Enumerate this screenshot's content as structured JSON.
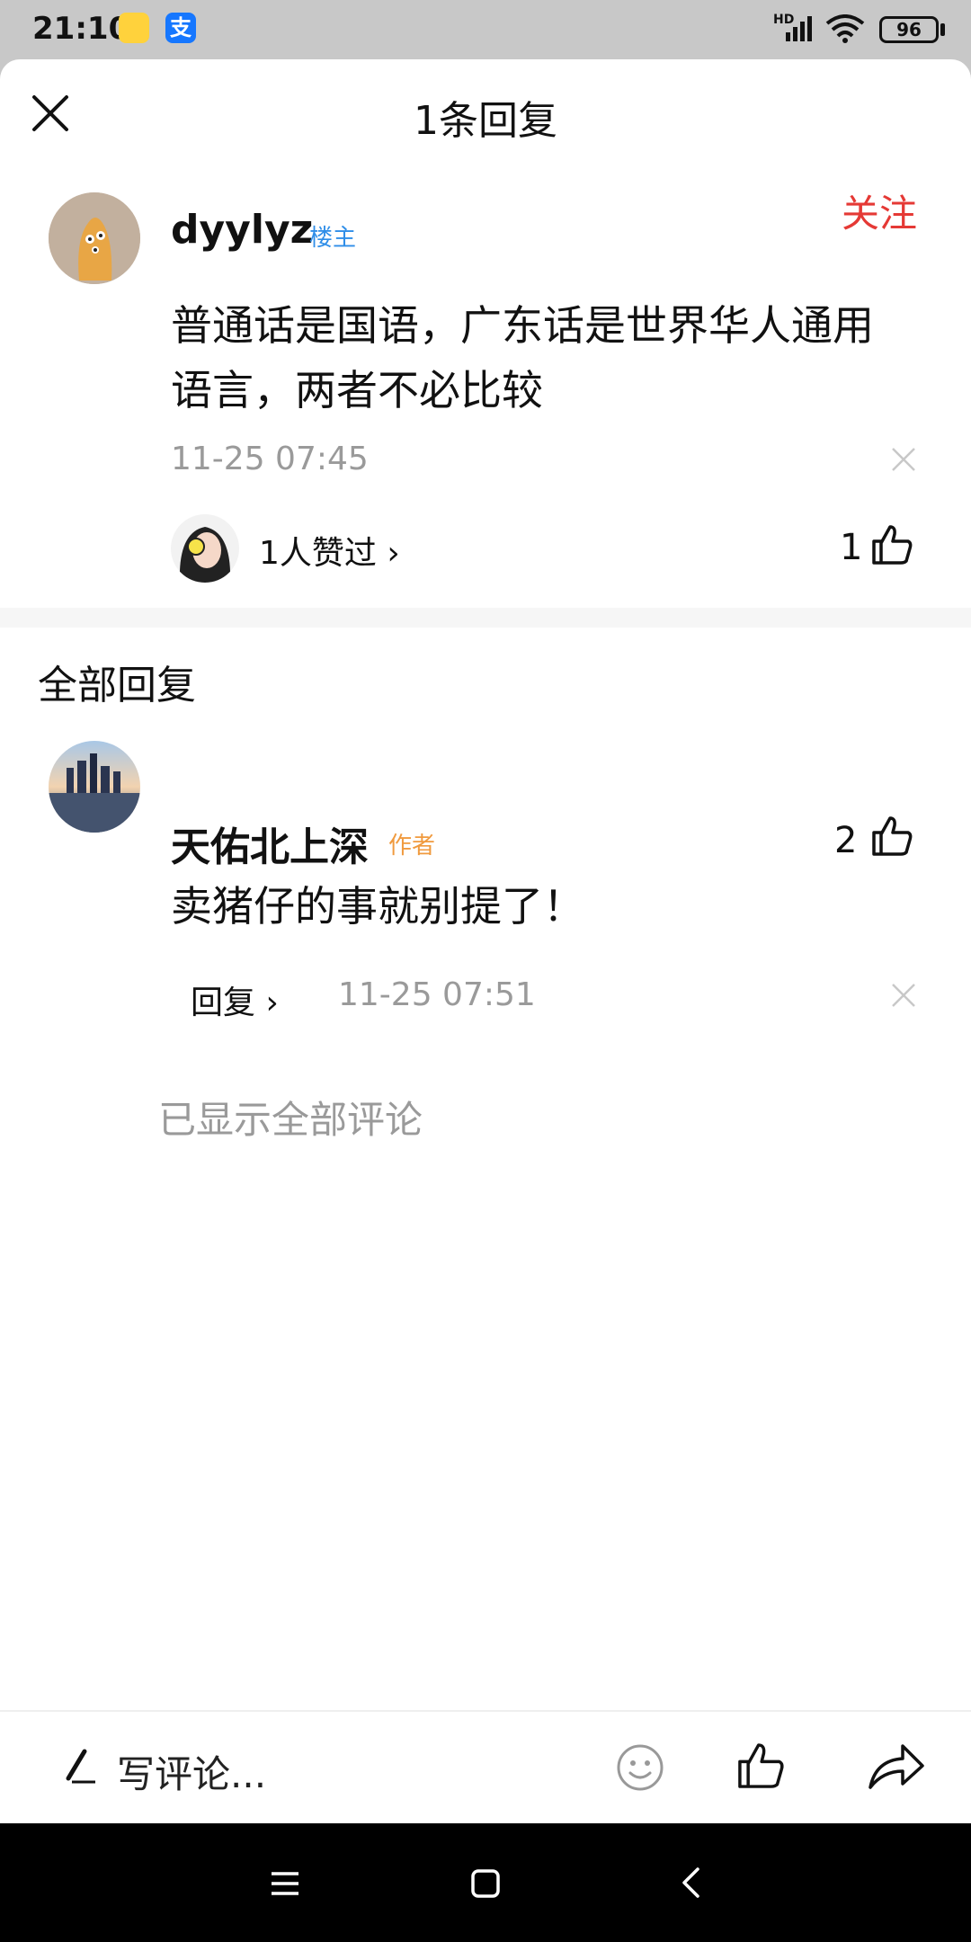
{
  "status_bar": {
    "time": "21:10",
    "network": "HD",
    "battery": "96",
    "app_icon_2_glyph": "支"
  },
  "header": {
    "title": "1条回复",
    "close_icon": "close-icon"
  },
  "main_comment": {
    "username": "dyylyz",
    "tag": "楼主",
    "follow_label": "关注",
    "text_line1": "普通话是国语，广东话是世界华人通用",
    "text_line2": "语言，两者不必比较",
    "time": "11-25 07:45",
    "liked_by": "1人赞过 ›",
    "likes": "1"
  },
  "replies_section": {
    "label": "全部回复",
    "items": [
      {
        "username": "天佑北上深",
        "tag": "作者",
        "likes": "2",
        "text": "卖猪仔的事就别提了！",
        "reply_label": "回复 ›",
        "time": "11-25 07:51"
      }
    ],
    "end_note": "已显示全部评论"
  },
  "bottom_bar": {
    "write_placeholder": "写评论..."
  },
  "colors": {
    "accent_red": "#e53935",
    "host_tag_blue": "#2f8ee8",
    "author_tag_orange": "#f09a3e",
    "muted_gray": "#9a9a9a"
  }
}
